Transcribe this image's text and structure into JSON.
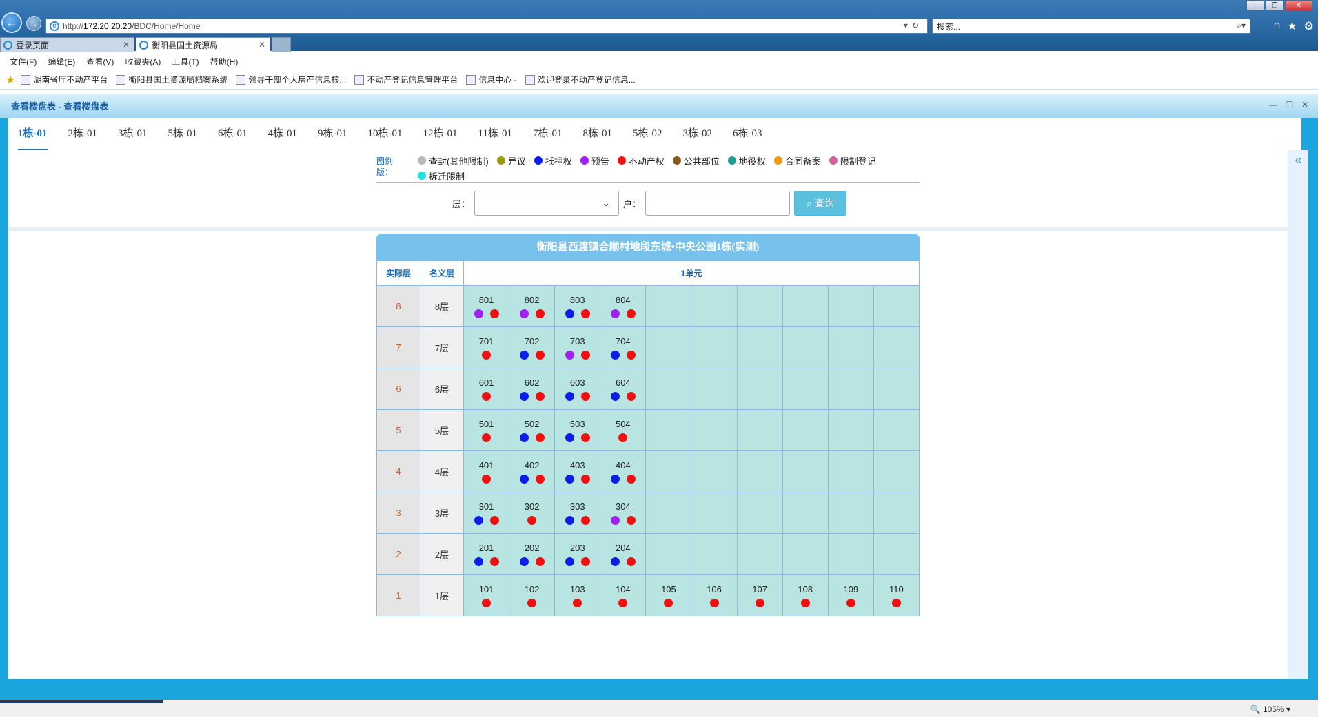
{
  "browser": {
    "address_prefix": "http://",
    "address_host": "172.20.20.20",
    "address_path": "/BDC/Home/Home",
    "search_placeholder": "搜索...",
    "tabs": [
      {
        "label": "登录页面",
        "active": false
      },
      {
        "label": "衡阳县国土资源局",
        "active": true
      }
    ],
    "menu": [
      "文件(F)",
      "编辑(E)",
      "查看(V)",
      "收藏夹(A)",
      "工具(T)",
      "帮助(H)"
    ],
    "favorites": [
      "湖南省厅不动产平台",
      "衡阳县国土资源局档案系统",
      "领导干部个人房产信息核...",
      "不动产登记信息管理平台",
      "信息中心 -",
      "欢迎登录不动产登记信息..."
    ],
    "zoom": "105%"
  },
  "frame": {
    "title": "查看楼盘表 - 查看楼盘表"
  },
  "building_tabs": [
    "1栋-01",
    "2栋-01",
    "3栋-01",
    "5栋-01",
    "6栋-01",
    "4栋-01",
    "9栋-01",
    "10栋-01",
    "12栋-01",
    "11栋-01",
    "7栋-01",
    "8栋-01",
    "5栋-02",
    "3栋-02",
    "6栋-03"
  ],
  "legend": {
    "title": "图例版：",
    "items": [
      {
        "label": "查封(其他限制)",
        "color": "#b9b9b9"
      },
      {
        "label": "异议",
        "color": "#9b9b12"
      },
      {
        "label": "抵押权",
        "color": "#0a1ee6"
      },
      {
        "label": "预告",
        "color": "#a020f0"
      },
      {
        "label": "不动产权",
        "color": "#ee1111"
      },
      {
        "label": "公共部位",
        "color": "#8b5a1a"
      },
      {
        "label": "地役权",
        "color": "#20a090"
      },
      {
        "label": "合同备案",
        "color": "#f39a12"
      },
      {
        "label": "限制登记",
        "color": "#d0649a"
      },
      {
        "label": "拆迁限制",
        "color": "#1ee0e0"
      }
    ]
  },
  "filter": {
    "floor_label": "层：",
    "unit_label": "户：",
    "query_label": "查询"
  },
  "building": {
    "title": "衡阳县西渡镇合顺村地段东城•中央公园1栋(实测)",
    "col_actual": "实际层",
    "col_nominal": "名义层",
    "col_unit": "1单元",
    "colors": {
      "red": "#ee1111",
      "blue": "#0a1ee6",
      "purple": "#a020f0"
    },
    "rows": [
      {
        "actual": "8",
        "nominal": "8层",
        "rooms": [
          {
            "no": "801",
            "d": [
              "purple",
              "red"
            ]
          },
          {
            "no": "802",
            "d": [
              "purple",
              "red"
            ]
          },
          {
            "no": "803",
            "d": [
              "blue",
              "red"
            ]
          },
          {
            "no": "804",
            "d": [
              "purple",
              "red"
            ]
          }
        ]
      },
      {
        "actual": "7",
        "nominal": "7层",
        "rooms": [
          {
            "no": "701",
            "d": [
              "red"
            ]
          },
          {
            "no": "702",
            "d": [
              "blue",
              "red"
            ]
          },
          {
            "no": "703",
            "d": [
              "purple",
              "red"
            ]
          },
          {
            "no": "704",
            "d": [
              "blue",
              "red"
            ]
          }
        ]
      },
      {
        "actual": "6",
        "nominal": "6层",
        "rooms": [
          {
            "no": "601",
            "d": [
              "red"
            ]
          },
          {
            "no": "602",
            "d": [
              "blue",
              "red"
            ]
          },
          {
            "no": "603",
            "d": [
              "blue",
              "red"
            ]
          },
          {
            "no": "604",
            "d": [
              "blue",
              "red"
            ]
          }
        ]
      },
      {
        "actual": "5",
        "nominal": "5层",
        "rooms": [
          {
            "no": "501",
            "d": [
              "red"
            ]
          },
          {
            "no": "502",
            "d": [
              "blue",
              "red"
            ]
          },
          {
            "no": "503",
            "d": [
              "blue",
              "red"
            ]
          },
          {
            "no": "504",
            "d": [
              "red"
            ]
          }
        ]
      },
      {
        "actual": "4",
        "nominal": "4层",
        "rooms": [
          {
            "no": "401",
            "d": [
              "red"
            ]
          },
          {
            "no": "402",
            "d": [
              "blue",
              "red"
            ]
          },
          {
            "no": "403",
            "d": [
              "blue",
              "red"
            ]
          },
          {
            "no": "404",
            "d": [
              "blue",
              "red"
            ]
          }
        ]
      },
      {
        "actual": "3",
        "nominal": "3层",
        "rooms": [
          {
            "no": "301",
            "d": [
              "blue",
              "red"
            ]
          },
          {
            "no": "302",
            "d": [
              "red"
            ]
          },
          {
            "no": "303",
            "d": [
              "blue",
              "red"
            ]
          },
          {
            "no": "304",
            "d": [
              "purple",
              "red"
            ]
          }
        ]
      },
      {
        "actual": "2",
        "nominal": "2层",
        "rooms": [
          {
            "no": "201",
            "d": [
              "blue",
              "red"
            ]
          },
          {
            "no": "202",
            "d": [
              "blue",
              "red"
            ]
          },
          {
            "no": "203",
            "d": [
              "blue",
              "red"
            ]
          },
          {
            "no": "204",
            "d": [
              "blue",
              "red"
            ]
          }
        ]
      },
      {
        "actual": "1",
        "nominal": "1层",
        "rooms": [
          {
            "no": "101",
            "d": [
              "red"
            ]
          },
          {
            "no": "102",
            "d": [
              "red"
            ]
          },
          {
            "no": "103",
            "d": [
              "red"
            ]
          },
          {
            "no": "104",
            "d": [
              "red"
            ]
          },
          {
            "no": "105",
            "d": [
              "red"
            ]
          },
          {
            "no": "106",
            "d": [
              "red"
            ]
          },
          {
            "no": "107",
            "d": [
              "red"
            ]
          },
          {
            "no": "108",
            "d": [
              "red"
            ]
          },
          {
            "no": "109",
            "d": [
              "red"
            ]
          },
          {
            "no": "110",
            "d": [
              "red"
            ]
          }
        ]
      }
    ]
  }
}
